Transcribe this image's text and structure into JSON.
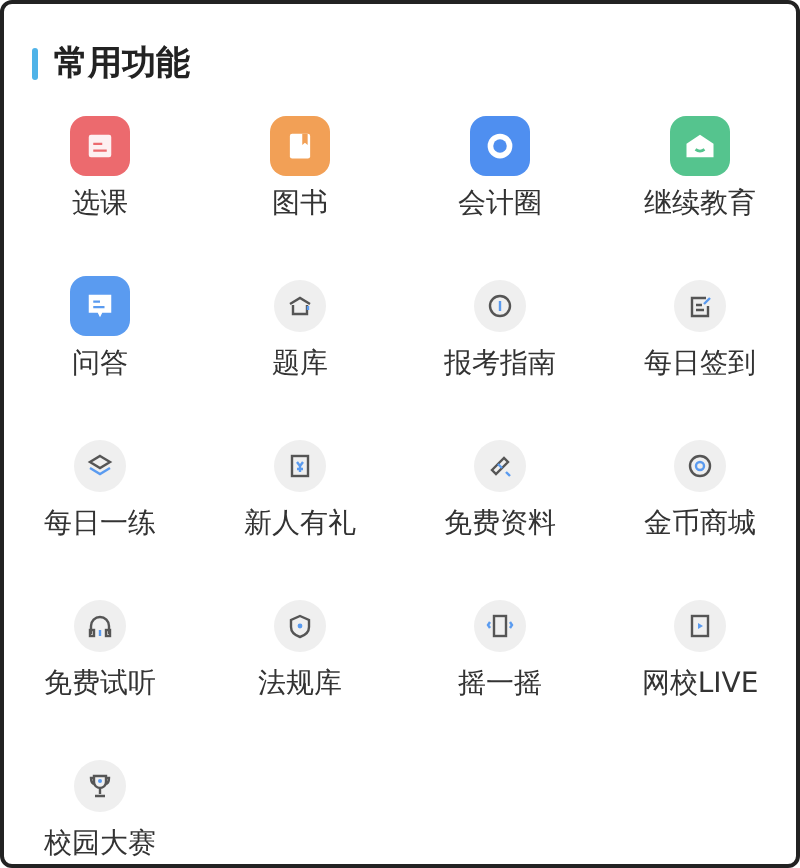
{
  "section": {
    "title": "常用功能"
  },
  "items": [
    {
      "label": "选课",
      "kind": "colored",
      "color": "#ec6a6e"
    },
    {
      "label": "图书",
      "kind": "colored",
      "color": "#f2a056"
    },
    {
      "label": "会计圈",
      "kind": "colored",
      "color": "#4f8ff0"
    },
    {
      "label": "继续教育",
      "kind": "colored",
      "color": "#55c48e"
    },
    {
      "label": "问答",
      "kind": "colored",
      "color": "#5a9bf0"
    },
    {
      "label": "题库",
      "kind": "plain"
    },
    {
      "label": "报考指南",
      "kind": "plain"
    },
    {
      "label": "每日签到",
      "kind": "plain"
    },
    {
      "label": "每日一练",
      "kind": "plain"
    },
    {
      "label": "新人有礼",
      "kind": "plain"
    },
    {
      "label": "免费资料",
      "kind": "plain"
    },
    {
      "label": "金币商城",
      "kind": "plain"
    },
    {
      "label": "免费试听",
      "kind": "plain"
    },
    {
      "label": "法规库",
      "kind": "plain"
    },
    {
      "label": "摇一摇",
      "kind": "plain"
    },
    {
      "label": "网校LIVE",
      "kind": "plain"
    },
    {
      "label": "校园大赛",
      "kind": "plain"
    }
  ]
}
